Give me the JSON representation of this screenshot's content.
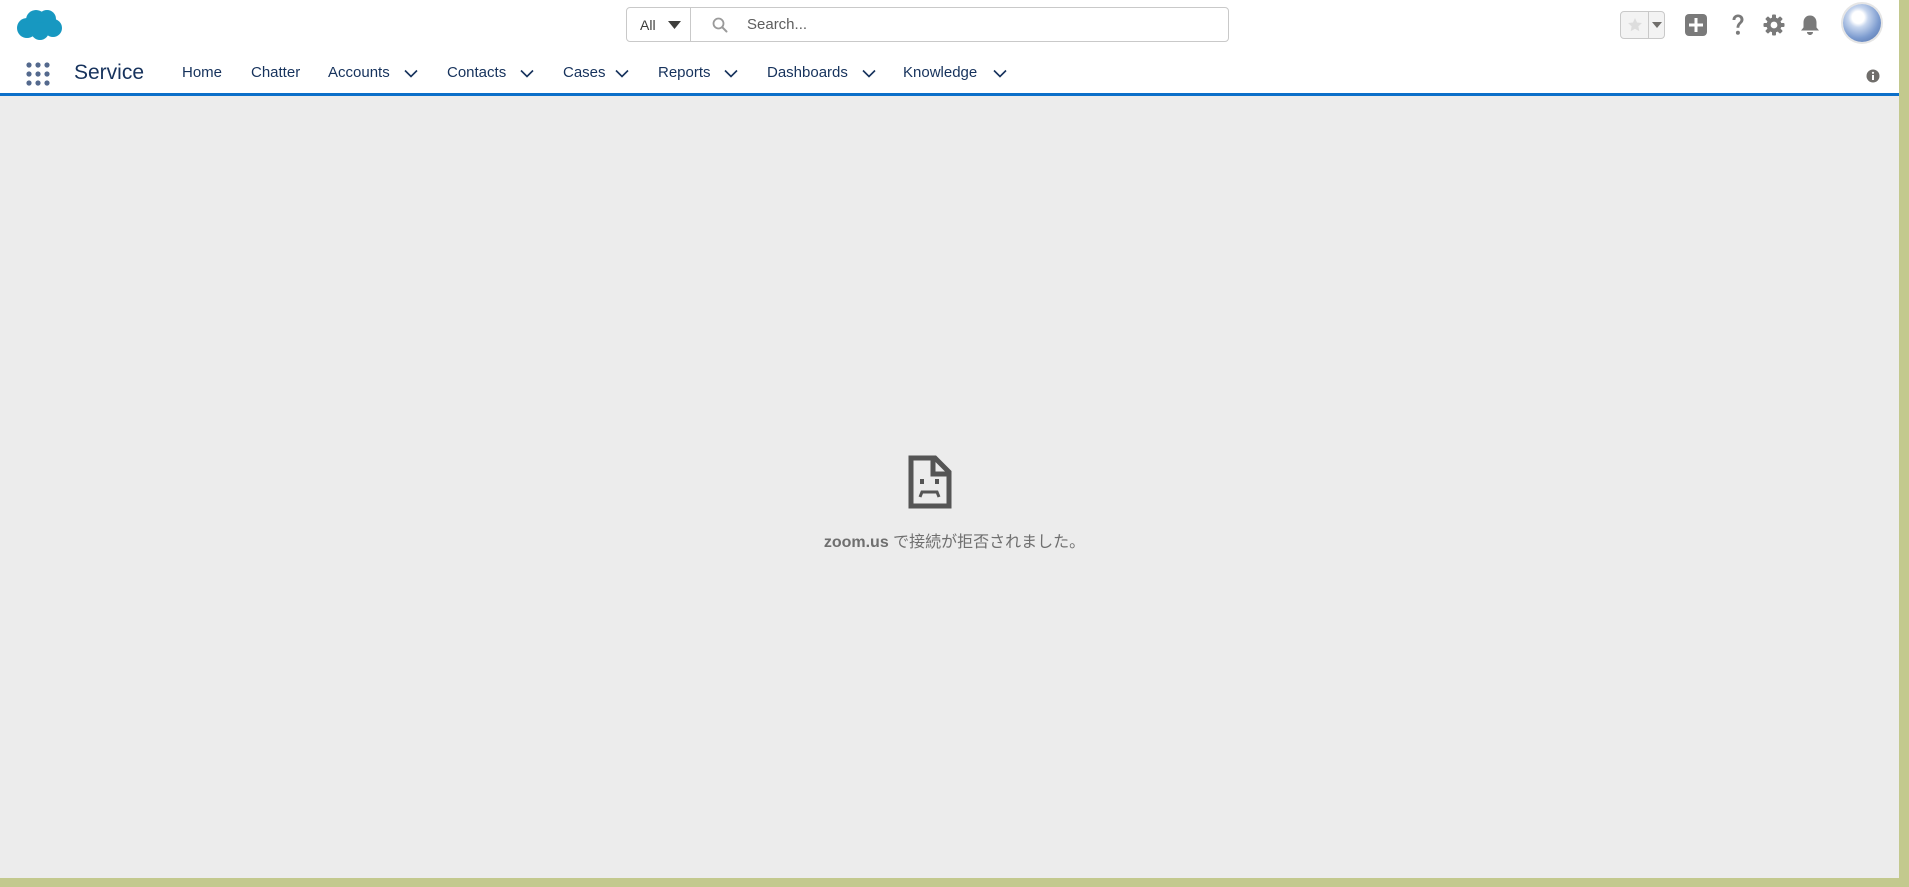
{
  "colors": {
    "brand": "#1798c1",
    "nav_accent": "#0b6fc9",
    "content_bg": "#ececec",
    "window_frame": "#c3c98e"
  },
  "header": {
    "logo_icon": "salesforce-cloud-icon",
    "search": {
      "scope_value": "All",
      "placeholder": "Search...",
      "value": ""
    },
    "icons": [
      "favorites-star-icon",
      "favorites-menu-icon",
      "global-actions-plus-icon",
      "help-icon",
      "setup-gear-icon",
      "notifications-bell-icon",
      "user-avatar"
    ]
  },
  "nav": {
    "app_launcher_icon": "app-launcher-grid-icon",
    "app_name": "Service",
    "items": [
      {
        "label": "Home",
        "has_menu": false
      },
      {
        "label": "Chatter",
        "has_menu": false
      },
      {
        "label": "Accounts",
        "has_menu": true
      },
      {
        "label": "Contacts",
        "has_menu": true
      },
      {
        "label": "Cases",
        "has_menu": true
      },
      {
        "label": "Reports",
        "has_menu": true
      },
      {
        "label": "Dashboards",
        "has_menu": true
      },
      {
        "label": "Knowledge",
        "has_menu": true
      }
    ],
    "info_icon": "info-icon"
  },
  "content": {
    "error_icon": "sad-document-icon",
    "error_host": "zoom.us",
    "error_message": " で接続が拒否されました。"
  }
}
